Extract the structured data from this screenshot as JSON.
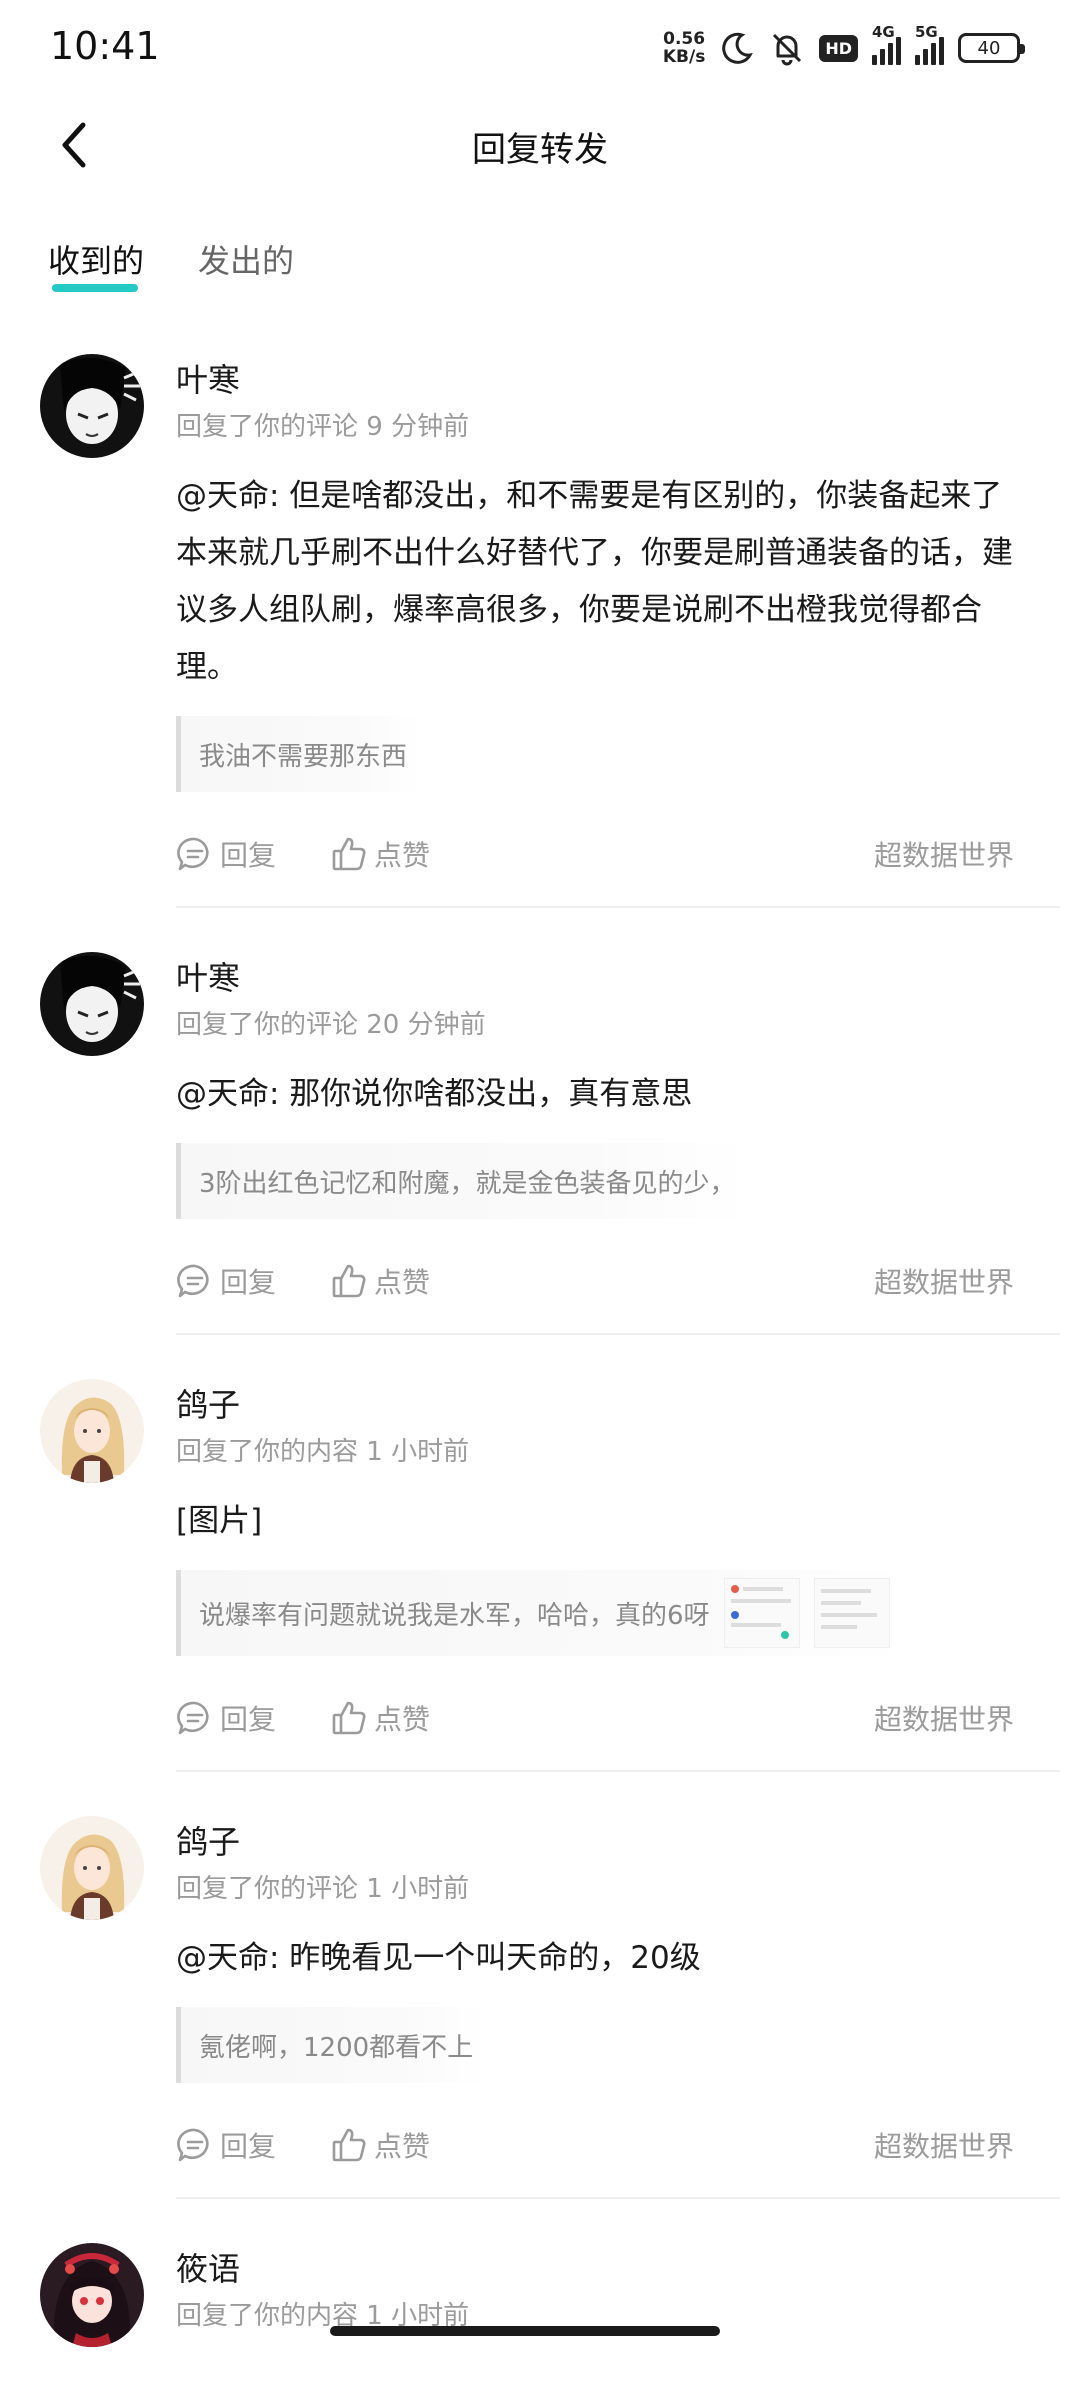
{
  "status_bar": {
    "time": "10:41",
    "net_speed_value": "0.56",
    "net_speed_unit": "KB/s",
    "hd_label": "HD",
    "signal1_label": "4G",
    "signal2_label": "5G",
    "battery": "40"
  },
  "header": {
    "title": "回复转发"
  },
  "tabs": [
    {
      "label": "收到的",
      "active": true
    },
    {
      "label": "发出的",
      "active": false
    }
  ],
  "actions": {
    "reply_label": "回复",
    "like_label": "点赞"
  },
  "items": [
    {
      "username": "叶寒",
      "meta": "回复了你的评论 9 分钟前",
      "content": "@天命: 但是啥都没出，和不需要是有区别的，你装备起来了本来就几乎刷不出什么好替代了，你要是刷普通装备的话，建议多人组队刷，爆率高很多，你要是说刷不出橙我觉得都合理。",
      "quote": "我油不需要那东西",
      "source": "超数据世界"
    },
    {
      "username": "叶寒",
      "meta": "回复了你的评论 20 分钟前",
      "content": "@天命: 那你说你啥都没出，真有意思",
      "quote": "3阶出红色记忆和附魔，就是金色装备见的少，",
      "source": "超数据世界"
    },
    {
      "username": "鸽子",
      "meta": "回复了你的内容 1 小时前",
      "content": "[图片]",
      "quote": "说爆率有问题就说我是水军，哈哈，真的6呀",
      "source": "超数据世界"
    },
    {
      "username": "鸽子",
      "meta": "回复了你的评论 1 小时前",
      "content": "@天命: 昨晚看见一个叫天命的，20级",
      "quote": "氪佬啊，1200都看不上",
      "source": "超数据世界"
    },
    {
      "username": "筱语",
      "meta": "回复了你的内容 1 小时前"
    }
  ]
}
